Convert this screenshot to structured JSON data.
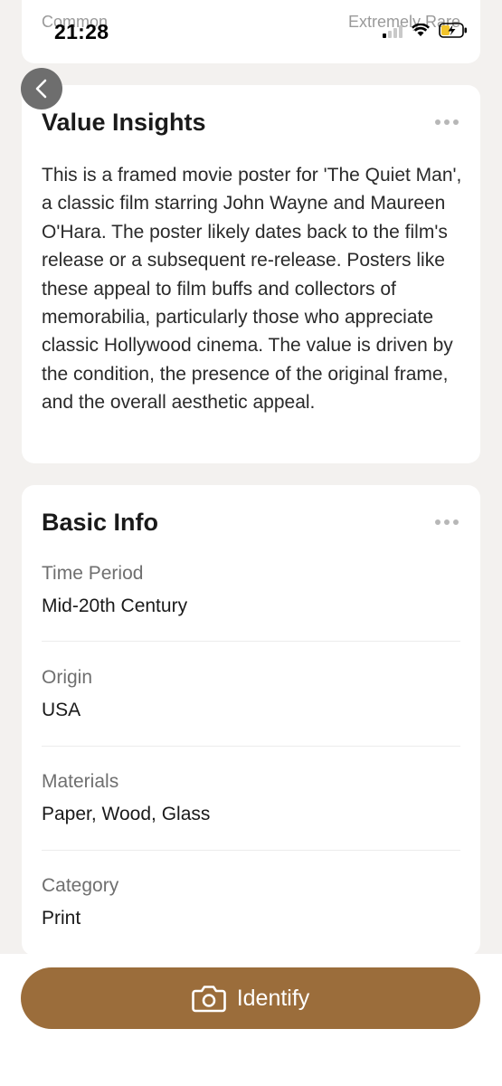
{
  "status_bar": {
    "time": "21:28",
    "icons": [
      "cellular-signal-icon",
      "wifi-icon",
      "battery-charging-icon"
    ]
  },
  "rarity_scale": {
    "left_label": "Common",
    "right_label": "Extremely Rare"
  },
  "value_insights": {
    "title": "Value Insights",
    "text": "This is a framed movie poster for 'The Quiet Man', a classic film starring John Wayne and Maureen O'Hara. The poster likely dates back to the film's release or a subsequent re-release. Posters like these appeal to film buffs and collectors of memorabilia, particularly those who appreciate classic Hollywood cinema. The value is driven by the condition, the presence of the original frame, and the overall aesthetic appeal."
  },
  "basic_info": {
    "title": "Basic Info",
    "rows": [
      {
        "label": "Time Period",
        "value": "Mid-20th Century"
      },
      {
        "label": "Origin",
        "value": "USA"
      },
      {
        "label": "Materials",
        "value": "Paper, Wood, Glass"
      },
      {
        "label": "Category",
        "value": "Print"
      }
    ]
  },
  "identify_button": {
    "label": "Identify",
    "icon": "camera-icon"
  },
  "colors": {
    "background": "#f3f1ef",
    "card": "#ffffff",
    "accent": "#9b6d3b",
    "back_button": "#6e6e6e"
  }
}
